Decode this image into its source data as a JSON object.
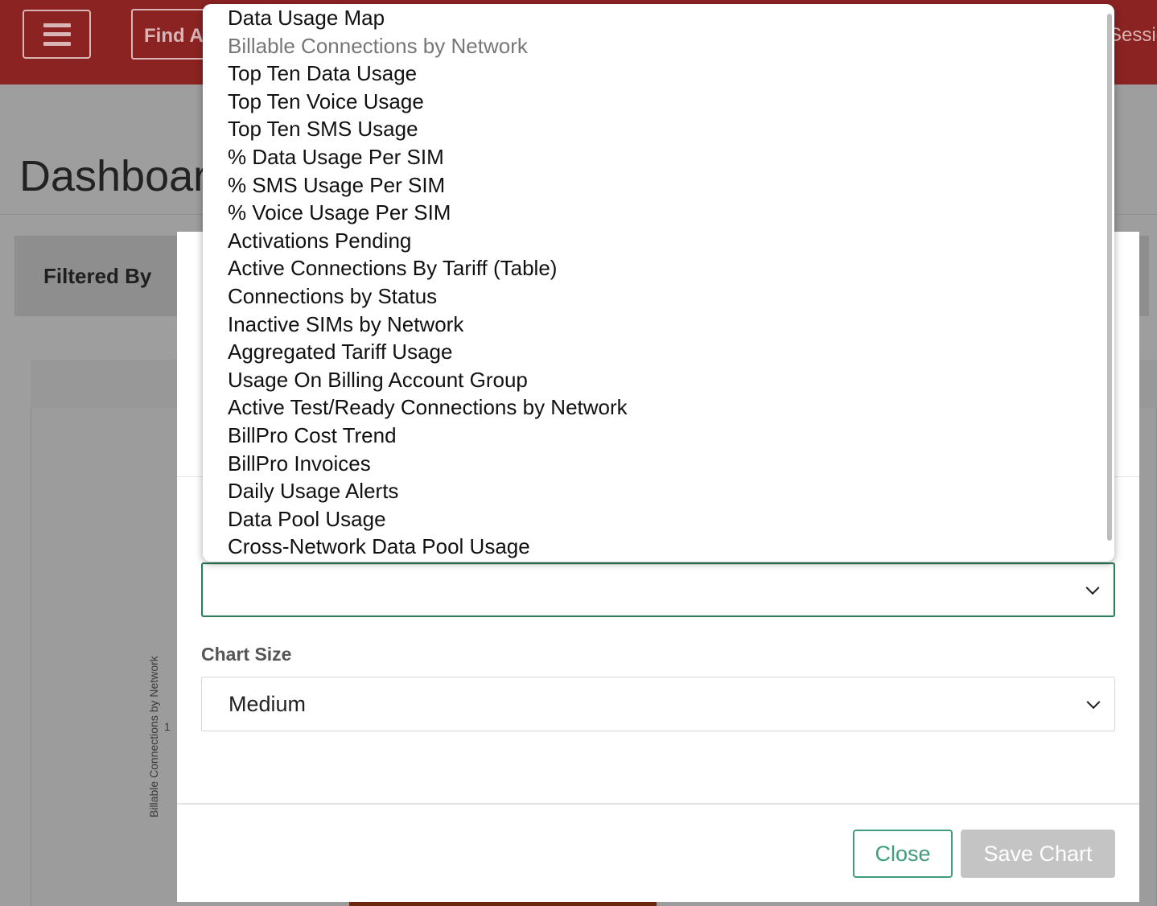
{
  "header": {
    "find_text": "Find A",
    "session_text": "Sessio"
  },
  "page": {
    "title": "Dashboar",
    "filtered_by_label": "Filtered By"
  },
  "chart_behind": {
    "y_axis_label": "Billable Connections by Network",
    "y_tick": "1"
  },
  "dropdown": {
    "options": [
      {
        "label": "Data Usage Map"
      },
      {
        "label": "Billable Connections by Network",
        "disabled": true
      },
      {
        "label": "Top Ten Data Usage"
      },
      {
        "label": "Top Ten Voice Usage"
      },
      {
        "label": "Top Ten SMS Usage"
      },
      {
        "label": "% Data Usage Per SIM"
      },
      {
        "label": "% SMS Usage Per SIM"
      },
      {
        "label": "% Voice Usage Per SIM"
      },
      {
        "label": "Activations Pending"
      },
      {
        "label": "Active Connections By Tariff (Table)"
      },
      {
        "label": "Connections by Status"
      },
      {
        "label": "Inactive SIMs by Network"
      },
      {
        "label": "Aggregated Tariff Usage"
      },
      {
        "label": "Usage On Billing Account Group"
      },
      {
        "label": "Active Test/Ready Connections by Network"
      },
      {
        "label": "BillPro Cost Trend"
      },
      {
        "label": "BillPro Invoices"
      },
      {
        "label": "Daily Usage Alerts"
      },
      {
        "label": "Data Pool Usage"
      },
      {
        "label": "Cross-Network Data Pool Usage"
      }
    ]
  },
  "modal": {
    "chart_type_value": "",
    "chart_size_label": "Chart Size",
    "chart_size_value": "Medium",
    "close_label": "Close",
    "save_label": "Save Chart"
  },
  "colors": {
    "header_bg": "#8c2323",
    "accent_green": "#2e7d5b",
    "close_green": "#3f9c7d",
    "disabled_button": "#c4c4c4"
  }
}
